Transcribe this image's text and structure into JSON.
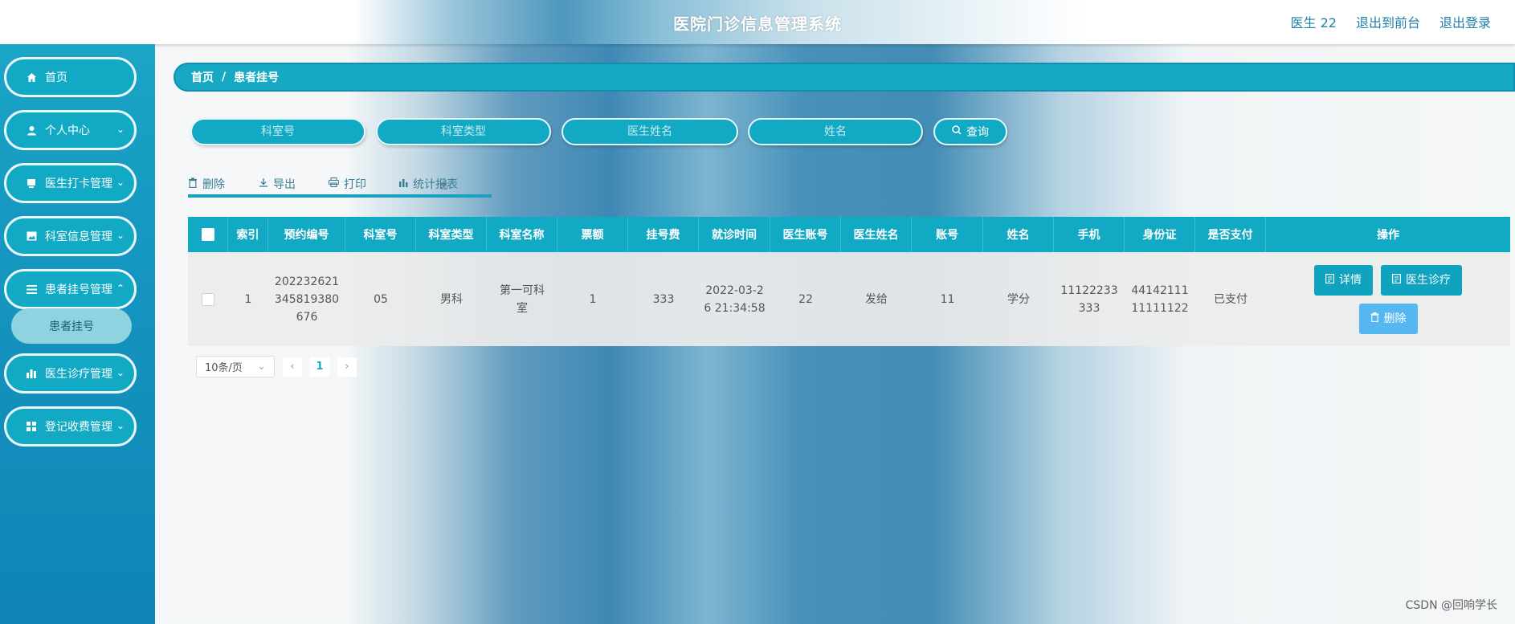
{
  "header": {
    "title": "医院门诊信息管理系统",
    "user": "医生 22",
    "to_front": "退出到前台",
    "logout": "退出登录"
  },
  "sidebar": {
    "items": [
      {
        "label": "首页",
        "icon": "home-icon"
      },
      {
        "label": "个人中心",
        "icon": "user-icon"
      },
      {
        "label": "医生打卡管理",
        "icon": "card-icon"
      },
      {
        "label": "科室信息管理",
        "icon": "image-icon"
      },
      {
        "label": "患者挂号管理",
        "icon": "list-icon"
      },
      {
        "label": "医生诊疗管理",
        "icon": "bar-chart-icon"
      },
      {
        "label": "登记收费管理",
        "icon": "grid-icon"
      }
    ],
    "sub_item": "患者挂号"
  },
  "breadcrumb": {
    "home": "首页",
    "sep": "/",
    "current": "患者挂号"
  },
  "search": {
    "dept_no_placeholder": "科室号",
    "dept_type_placeholder": "科室类型",
    "doctor_name_placeholder": "医生姓名",
    "name_placeholder": "姓名",
    "button": "查询"
  },
  "toolbar": {
    "delete": "删除",
    "export": "导出",
    "print": "打印",
    "report": "统计报表"
  },
  "table": {
    "headers": [
      "索引",
      "预约编号",
      "科室号",
      "科室类型",
      "科室名称",
      "票额",
      "挂号费",
      "就诊时间",
      "医生账号",
      "医生姓名",
      "账号",
      "姓名",
      "手机",
      "身份证",
      "是否支付",
      "操作"
    ],
    "row": {
      "index": "1",
      "appointment_no": "202232621345819380676",
      "dept_no": "05",
      "dept_type": "男科",
      "dept_name": "第一可科室",
      "ticket": "1",
      "fee": "333",
      "visit_time": "2022-03-26 21:34:58",
      "doctor_account": "22",
      "doctor_name": "发给",
      "account": "11",
      "name": "学分",
      "phone": "11122233333",
      "id_card": "4414211111111122",
      "paid": "已支付",
      "btn_detail": "详情",
      "btn_diagnosis": "医生诊疗",
      "btn_delete": "删除"
    }
  },
  "pager": {
    "size": "10条/页",
    "page": "1"
  },
  "watermark": "CSDN @回响学长",
  "colors": {
    "accent": "#12a9c4",
    "danger_btn": "#56b6ef"
  }
}
